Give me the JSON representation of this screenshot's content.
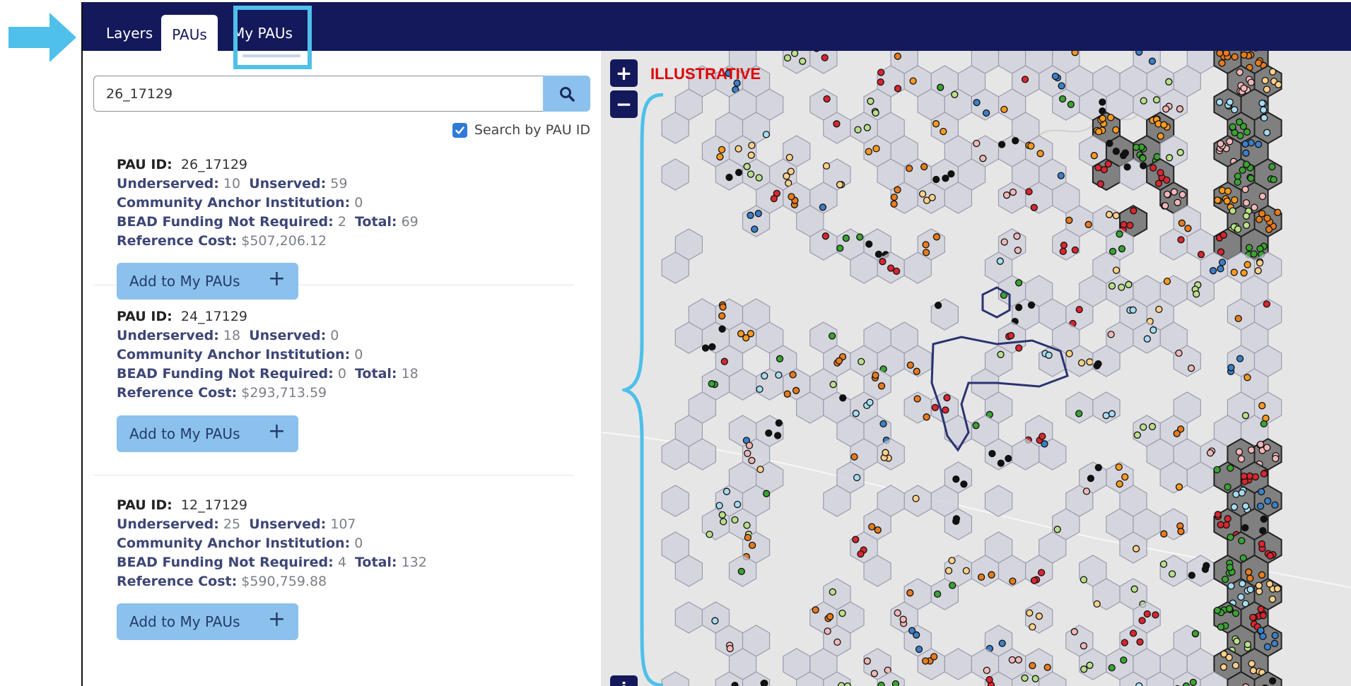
{
  "tabs": {
    "layers": "Layers",
    "paus": "PAUs",
    "my_paus": "My PAUs"
  },
  "search": {
    "value": "26_17129",
    "by_id_label": "Search by PAU ID",
    "by_id_checked": true
  },
  "labels": {
    "pau_id": "PAU ID:",
    "underserved": "Underserved:",
    "unserved": "Unserved:",
    "cai": "Community Anchor Institution:",
    "bead": "BEAD Funding Not Required:",
    "total": "Total:",
    "ref_cost": "Reference Cost:",
    "add_button": "Add to My PAUs"
  },
  "results": [
    {
      "pau_id": "26_17129",
      "underserved": "10",
      "unserved": "59",
      "cai": "0",
      "bead": "2",
      "total": "69",
      "ref_cost": "$507,206.12"
    },
    {
      "pau_id": "24_17129",
      "underserved": "18",
      "unserved": "0",
      "cai": "0",
      "bead": "0",
      "total": "18",
      "ref_cost": "$293,713.59"
    },
    {
      "pau_id": "12_17129",
      "underserved": "25",
      "unserved": "107",
      "cai": "0",
      "bead": "4",
      "total": "132",
      "ref_cost": "$590,759.88"
    }
  ],
  "map": {
    "zoom_in": "+",
    "zoom_out": "−",
    "info": "i",
    "watermark": "ILLUSTRATIVE"
  },
  "colors": {
    "nav": "#14195b",
    "accent": "#4ec0ea",
    "button": "#8bc1ec",
    "watermark": "#e00000"
  },
  "icons": {
    "search": "search-icon",
    "check": "check-icon",
    "plus": "plus-icon",
    "arrow": "arrow-right-icon",
    "brace": "curly-brace-icon"
  }
}
